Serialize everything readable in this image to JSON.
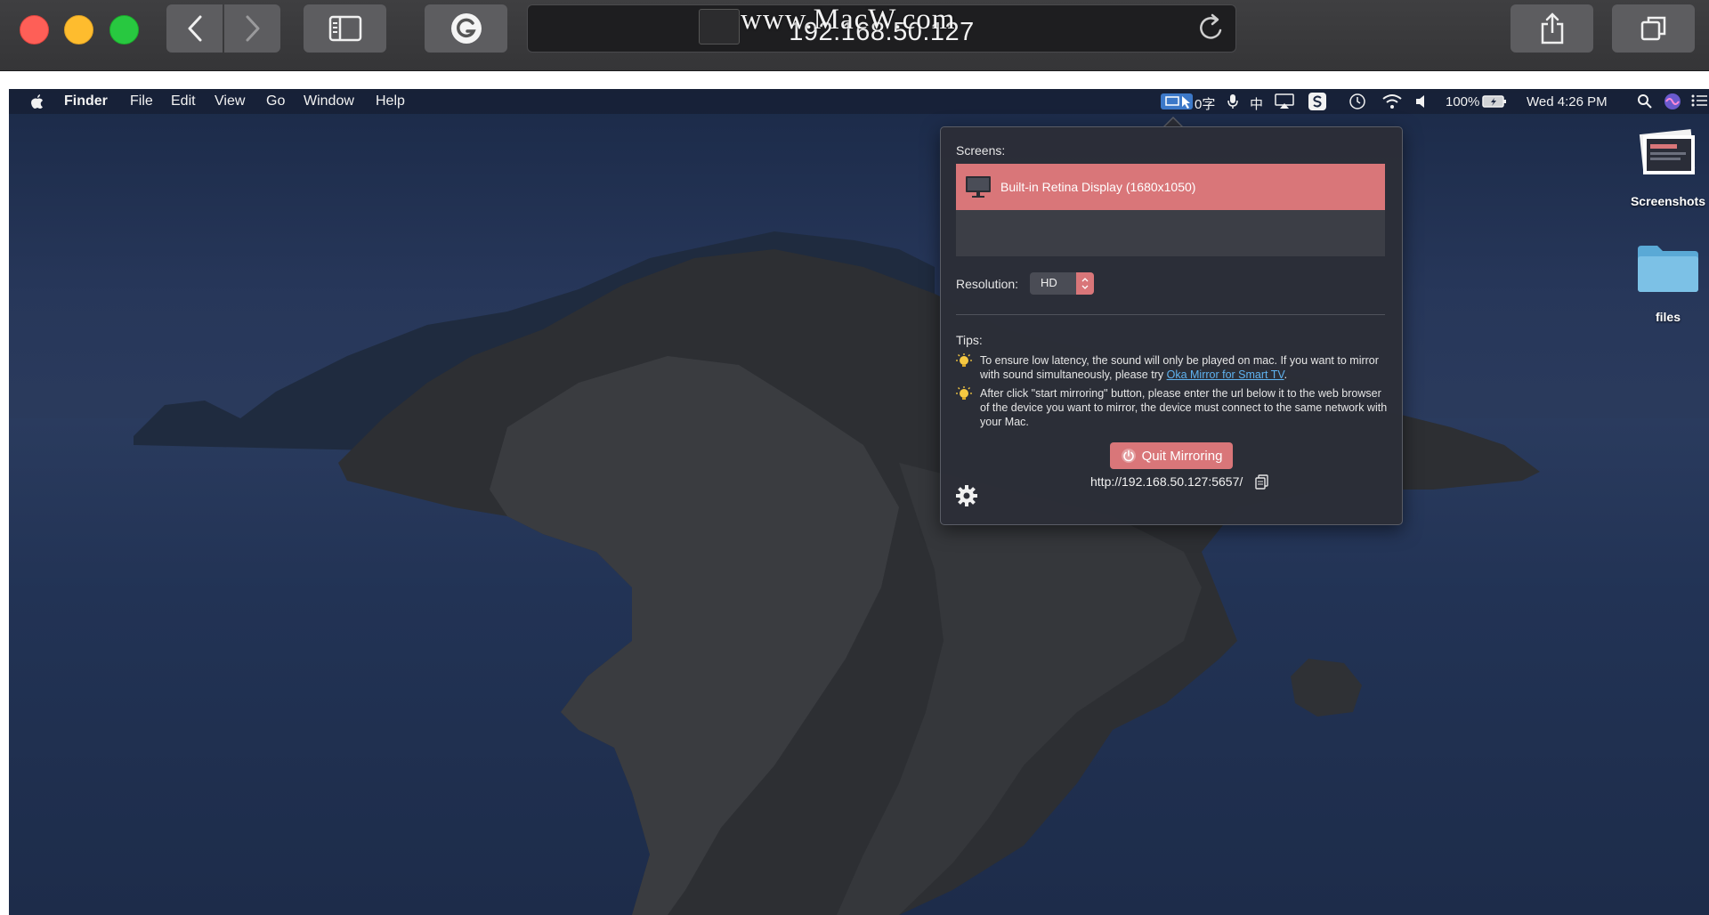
{
  "browser": {
    "url": "192.168.50.127",
    "watermark": "www.MacW.com"
  },
  "menubar": {
    "app_name": "Finder",
    "menus": [
      "File",
      "Edit",
      "View",
      "Go",
      "Window",
      "Help"
    ],
    "input_indicator": "0字",
    "chinese_input": "中",
    "battery": "100%",
    "datetime": "Wed 4:26 PM"
  },
  "desktop": {
    "icons": [
      {
        "label": "Screenshots"
      },
      {
        "label": "files"
      }
    ]
  },
  "popover": {
    "screens_label": "Screens:",
    "screens": [
      {
        "label": "Built-in Retina Display (1680x1050)",
        "selected": true
      }
    ],
    "resolution_label": "Resolution:",
    "resolution_value": "HD",
    "tips_label": "Tips:",
    "tip1_text": "To ensure low latency, the sound will only be played on mac. If you want to mirror with sound simultaneously, please try ",
    "tip1_link": "Oka Mirror for Smart TV",
    "tip1_end": ".",
    "tip2_text": "After click \"start mirroring\" button, please enter the url below it to the web browser of the device you want to mirror, the device must connect to the same network with your Mac.",
    "quit_label": "Quit Mirroring",
    "mirror_url": "http://192.168.50.127:5657/",
    "accent": "#d97679"
  }
}
